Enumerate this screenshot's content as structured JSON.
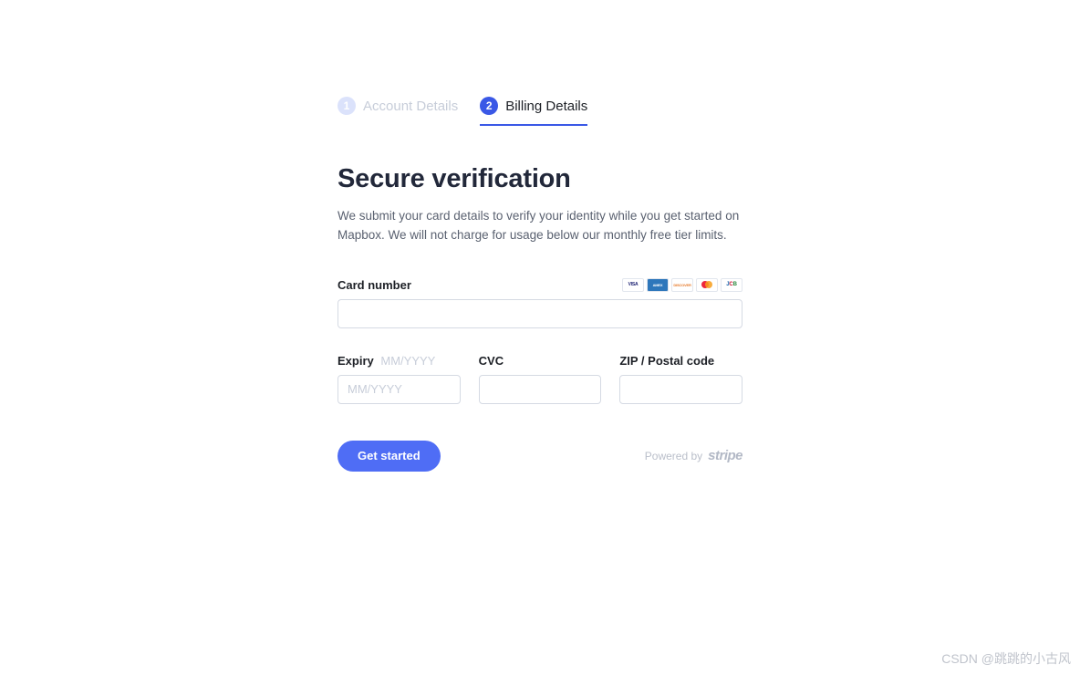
{
  "steps": {
    "step1": {
      "num": "1",
      "label": "Account Details"
    },
    "step2": {
      "num": "2",
      "label": "Billing Details"
    }
  },
  "heading": "Secure verification",
  "description": "We submit your card details to verify your identity while you get started on Mapbox. We will not charge for usage below our monthly free tier limits.",
  "labels": {
    "card_number": "Card number",
    "expiry": "Expiry",
    "expiry_hint": "MM/YYYY",
    "cvc": "CVC",
    "zip": "ZIP / Postal code"
  },
  "placeholders": {
    "expiry": "MM/YYYY"
  },
  "card_brands": {
    "visa": "VISA",
    "amex": "AMEX",
    "discover": "DISCOVER",
    "jcb_j": "J",
    "jcb_c": "C",
    "jcb_b": "B"
  },
  "buttons": {
    "get_started": "Get started"
  },
  "powered_by": {
    "prefix": "Powered by",
    "brand": "stripe"
  },
  "watermark": "CSDN @跳跳的小古风"
}
